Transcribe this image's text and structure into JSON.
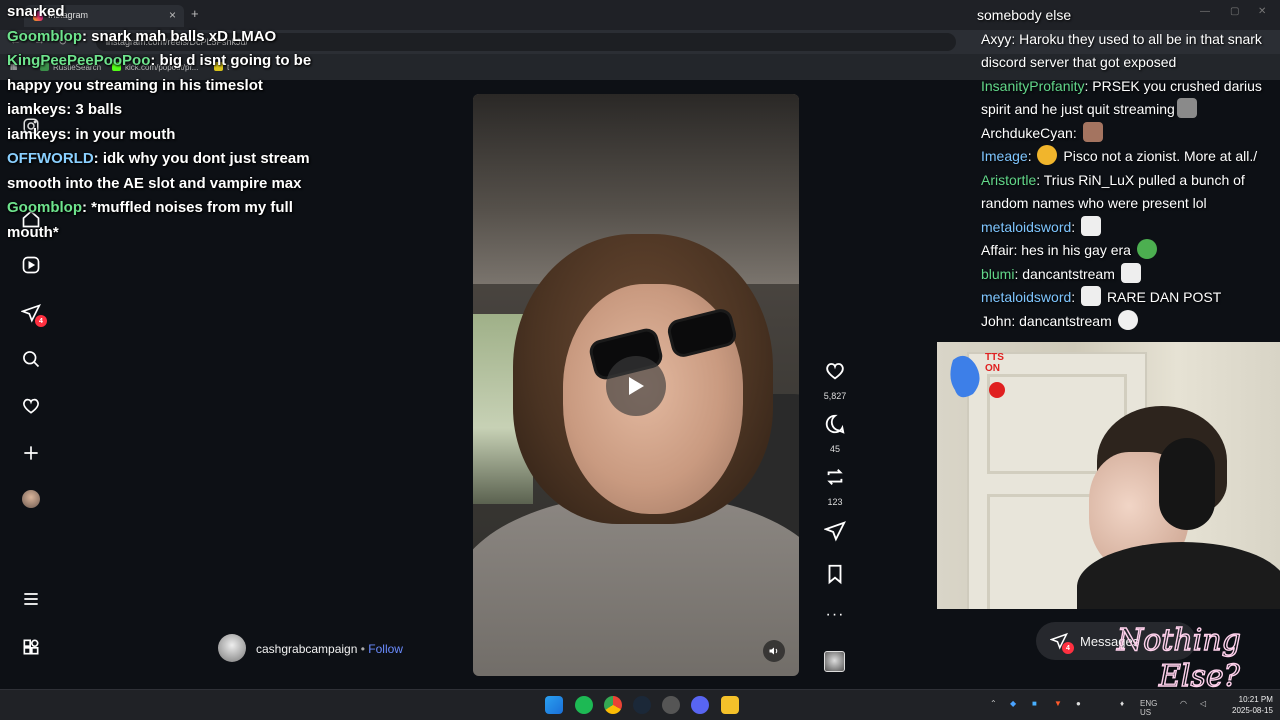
{
  "browser": {
    "tab_title": "Instagram",
    "url": "instagram.com/reels/DcPL5FshkJu/",
    "bookmarks": [
      {
        "label": "RustleSearch"
      },
      {
        "label": "kick.com/popout/pr..."
      },
      {
        "label": "t"
      }
    ]
  },
  "sidebar": {
    "notifications_badge": "4"
  },
  "reel": {
    "author": "cashgrabcampaign",
    "separator": "•",
    "follow_label": "Follow",
    "likes": "5,827",
    "comments": "45",
    "reposts": "123"
  },
  "overlay_chat": {
    "lines": [
      {
        "user": "",
        "text": "snarked"
      },
      {
        "user": "Goomblop",
        "text": "snark mah balls xD LMAO"
      },
      {
        "user": "KingPeePeePooPoo",
        "text": "big d isnt going to be happy you streaming in his timeslot"
      },
      {
        "user": "iamkeys",
        "text": "3 balls"
      },
      {
        "user": "iamkeys",
        "text": "in your mouth"
      },
      {
        "user": "OFFWORLD",
        "text": "idk why you dont just stream smooth into the AE slot and vampire max"
      },
      {
        "user": "Goomblop",
        "text": "*muffled noises from my full mouth*"
      }
    ]
  },
  "side_chat": {
    "header": "somebody else",
    "lines": [
      {
        "user": "Axyy",
        "text": "Haroku they used to all be in that snark discord server that got exposed"
      },
      {
        "user": "InsanityProfanity",
        "text": "PRSEK you crushed darius spirit and he just quit streaming"
      },
      {
        "user": "ArchdukeCyan",
        "text": ""
      },
      {
        "user": "Imeage",
        "text": "Pisco not a zionist. More at all./"
      },
      {
        "user": "Aristortle",
        "text": "Trius RiN_LuX pulled a bunch of random names who were present lol"
      },
      {
        "user": "metaloidsword",
        "text": ""
      },
      {
        "user": "Affair",
        "text": "hes in his gay era"
      },
      {
        "user": "blumi",
        "text": "dancantstream"
      },
      {
        "user": "metaloidsword",
        "text": "RARE DAN POST"
      },
      {
        "user": "John",
        "text": "dancantstream"
      }
    ]
  },
  "webcam": {
    "tts_label_1": "TTS",
    "tts_label_2": "ON"
  },
  "messages": {
    "label": "Messages",
    "badge": "4"
  },
  "logo": {
    "text_1": "Nothing",
    "text_2": "Else?"
  },
  "taskbar": {
    "lang": "ENG",
    "region": "US",
    "time": "10:21 PM",
    "date": "2025-08-15"
  }
}
